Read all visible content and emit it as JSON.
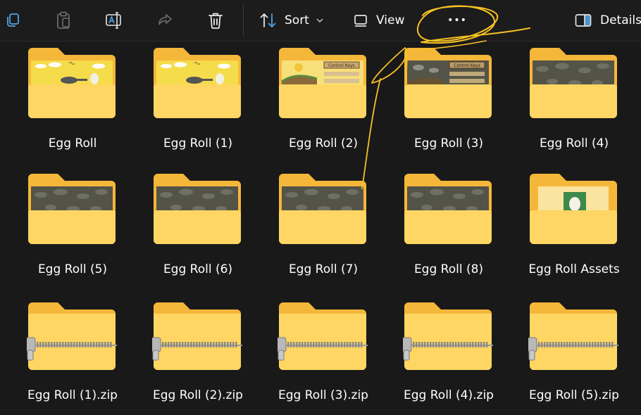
{
  "toolbar": {
    "sort_label": "Sort",
    "view_label": "View",
    "more_label": "•••",
    "details_label": "Details"
  },
  "files": [
    {
      "name": "Egg Roll",
      "kind": "folder",
      "thumb": "egg-scene"
    },
    {
      "name": "Egg Roll (1)",
      "kind": "folder",
      "thumb": "egg-scene"
    },
    {
      "name": "Egg Roll (2)",
      "kind": "folder",
      "thumb": "control-keys-light"
    },
    {
      "name": "Egg Roll (3)",
      "kind": "folder",
      "thumb": "control-keys-dark"
    },
    {
      "name": "Egg Roll (4)",
      "kind": "folder",
      "thumb": "dark-clouds"
    },
    {
      "name": "Egg Roll (5)",
      "kind": "folder",
      "thumb": "dark-clouds"
    },
    {
      "name": "Egg Roll (6)",
      "kind": "folder",
      "thumb": "dark-clouds"
    },
    {
      "name": "Egg Roll (7)",
      "kind": "folder",
      "thumb": "dark-clouds"
    },
    {
      "name": "Egg Roll (8)",
      "kind": "folder",
      "thumb": "dark-clouds"
    },
    {
      "name": "Egg Roll Assets",
      "kind": "folder",
      "thumb": "egg-card"
    },
    {
      "name": "Egg Roll (1).zip",
      "kind": "zip",
      "thumb": "zip"
    },
    {
      "name": "Egg Roll (2).zip",
      "kind": "zip",
      "thumb": "zip"
    },
    {
      "name": "Egg Roll (3).zip",
      "kind": "zip",
      "thumb": "zip"
    },
    {
      "name": "Egg Roll (4).zip",
      "kind": "zip",
      "thumb": "zip"
    },
    {
      "name": "Egg Roll (5).zip",
      "kind": "zip",
      "thumb": "zip"
    }
  ],
  "thumb_text": {
    "control_keys": "Control Keys"
  },
  "colors": {
    "background": "#191919",
    "folder_back": "#f4b73a",
    "folder_front": "#ffd663",
    "annotation": "#f7c223",
    "accent": "#4ea3e8"
  }
}
